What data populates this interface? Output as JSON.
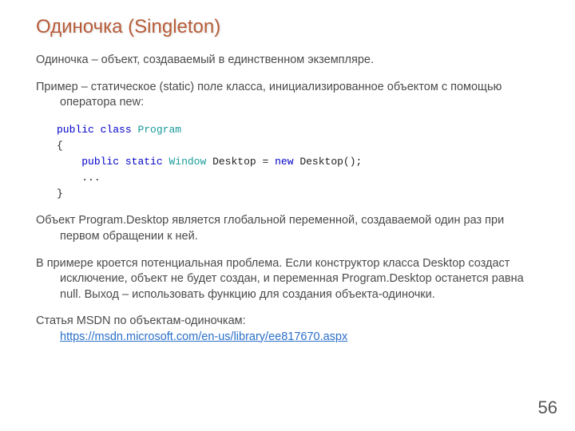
{
  "title": "Одиночка (Singleton)",
  "p1": "Одиночка – объект, создаваемый в единственном экземпляре.",
  "p2": "Пример – статическое (static) поле класса, инициализированное объектом с помощью оператора new:",
  "code": {
    "l1a": "public",
    "l1b": "class",
    "l1c": "Program",
    "l2": "{",
    "l3a": "public",
    "l3b": "static",
    "l3c": "Window",
    "l3d": " Desktop = ",
    "l3e": "new",
    "l3f": " Desktop();",
    "l4": "...",
    "l5": "}"
  },
  "p3": "Объект Program.Desktop является глобальной переменной, создаваемой один раз при первом обращении к ней.",
  "p4": "В примере кроется потенциальная проблема. Если конструктор класса Desktop создаст исключение, объект не будет создан, и переменная Program.Desktop останется равна null. Выход – использовать функцию для создания объекта-одиночки.",
  "p5_prefix": "Статья MSDN по объектам-одиночкам: ",
  "p5_link": "https://msdn.microsoft.com/en-us/library/ee817670.aspx",
  "page_number": "56"
}
